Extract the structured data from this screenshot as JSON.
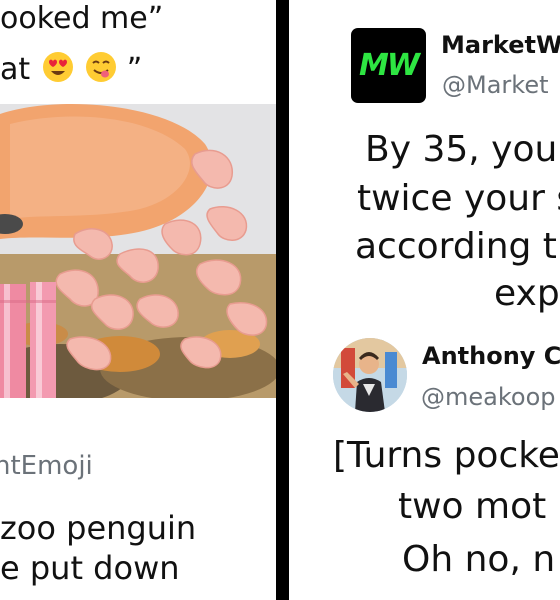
{
  "left_post": {
    "caption_line1": "ooked me”",
    "caption_line2_prefix": "at",
    "caption_line2_suffix": "”",
    "emojis": [
      "heart-eyes-emoji",
      "yum-emoji"
    ],
    "handle": "ntEmoji",
    "tweet_lines": [
      "zoo penguin",
      "e put down"
    ]
  },
  "right_top_tweet": {
    "account_name": "MarketW",
    "handle": "@Market",
    "logo_text": "MW",
    "logo_color": "#2ee542",
    "lines": [
      "By 35, you s",
      "twice your s",
      "according t",
      "exp"
    ]
  },
  "right_bottom_tweet": {
    "account_name": "Anthony C",
    "handle": "@meakoop",
    "lines": [
      "[Turns pocke",
      "two mot",
      "Oh no, n"
    ]
  }
}
